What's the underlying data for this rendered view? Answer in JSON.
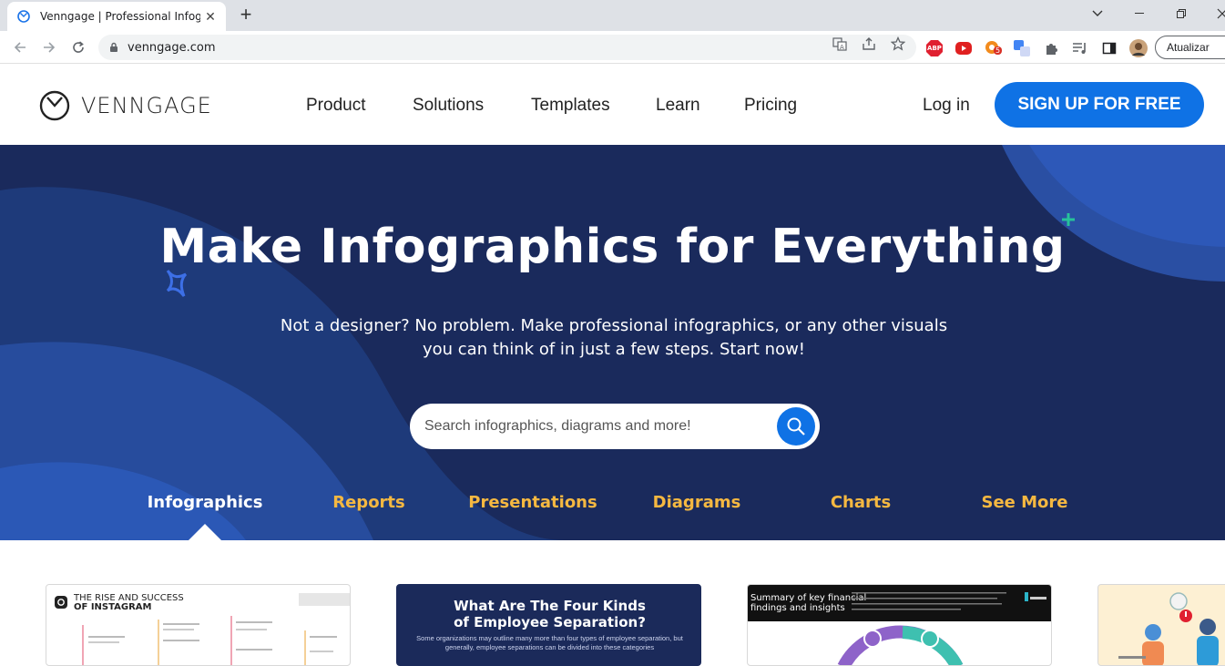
{
  "browser": {
    "tab_title": "Venngage | Professional Infograp",
    "url": "venngage.com",
    "update_button": "Atualizar",
    "extension_badge": "5",
    "abp_label": "ABP"
  },
  "header": {
    "logo_text": "VENNGAGE",
    "nav": [
      "Product",
      "Solutions",
      "Templates",
      "Learn",
      "Pricing"
    ],
    "login": "Log in",
    "signup": "SIGN UP FOR FREE"
  },
  "hero": {
    "title": "Make Infographics for Everything",
    "subtitle_line1": "Not a designer? No problem. Make professional infographics, or any other visuals",
    "subtitle_line2": "you can think of in just a few steps. Start now!",
    "search_placeholder": "Search infographics, diagrams and more!",
    "categories": [
      "Infographics",
      "Reports",
      "Presentations",
      "Diagrams",
      "Charts",
      "See More"
    ],
    "active_category": "Infographics"
  },
  "cards": {
    "card1_line1": "THE RISE AND SUCCESS",
    "card1_line2": "OF INSTAGRAM",
    "card2_line1": "What Are The Four Kinds",
    "card2_line2": "of Employee Separation?",
    "card2_sub": "Some organizations may outline many more than four types of employee separation, but generally, employee separations can be divided into these categories",
    "card3_line1": "Summary of key financial",
    "card3_line2": "findings and insights"
  },
  "colors": {
    "brand_blue": "#0f72e5",
    "hero_bg": "#1a2a5c",
    "category_gold": "#f5b841"
  }
}
